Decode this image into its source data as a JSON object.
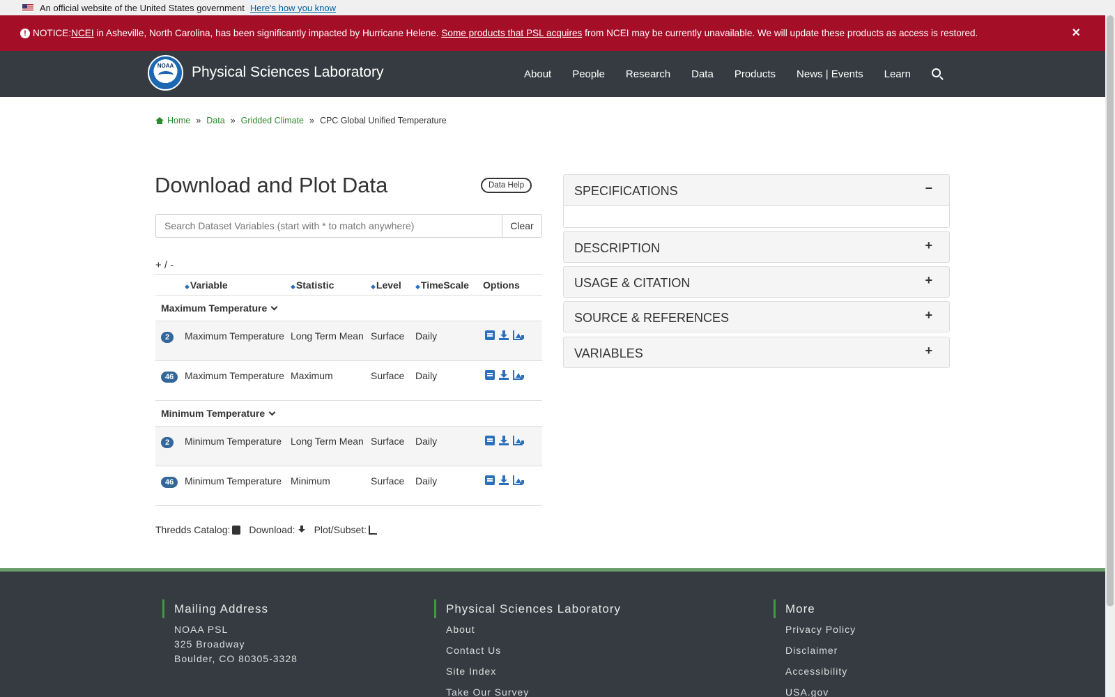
{
  "gov_banner": {
    "text": "An official website of the United States government",
    "link": "Here's how you know"
  },
  "notice": {
    "prefix": "NOTICE: ",
    "ncei_link": "NCEI",
    "text1": " in Asheville, North Carolina, has been significantly impacted by Hurricane Helene. ",
    "products_link": "Some products that PSL acquires",
    "text2": " from NCEI may be currently unavailable. We will update these products as access is restored.",
    "close": "×"
  },
  "header": {
    "logo_text": "NOAA",
    "title": "Physical Sciences Laboratory",
    "nav": [
      "About",
      "People",
      "Research",
      "Data",
      "Products",
      "News | Events",
      "Learn"
    ]
  },
  "breadcrumb": {
    "home": "Home",
    "data": "Data",
    "gridded": "Gridded Climate",
    "current": "CPC Global Unified Temperature",
    "sep": "»"
  },
  "main": {
    "title": "Download and Plot Data",
    "data_help": "Data Help",
    "search_placeholder": "Search Dataset Variables (start with * to match anywhere)",
    "clear": "Clear",
    "plusminus": "+ / -",
    "columns": {
      "variable": "Variable",
      "statistic": "Statistic",
      "level": "Level",
      "timescale": "TimeScale",
      "options": "Options"
    },
    "groups": [
      {
        "name": "Maximum Temperature",
        "rows": [
          {
            "count": "2",
            "variable": "Maximum Temperature",
            "statistic": "Long Term Mean",
            "level": "Surface",
            "timescale": "Daily"
          },
          {
            "count": "46",
            "variable": "Maximum Temperature",
            "statistic": "Maximum",
            "level": "Surface",
            "timescale": "Daily"
          }
        ]
      },
      {
        "name": "Minimum Temperature",
        "rows": [
          {
            "count": "2",
            "variable": "Minimum Temperature",
            "statistic": "Long Term Mean",
            "level": "Surface",
            "timescale": "Daily"
          },
          {
            "count": "46",
            "variable": "Minimum Temperature",
            "statistic": "Minimum",
            "level": "Surface",
            "timescale": "Daily"
          }
        ]
      }
    ],
    "legend": {
      "thredds": "Thredds Catalog:",
      "download": "Download:",
      "plot": "Plot/Subset:"
    }
  },
  "accordion": [
    {
      "title": "SPECIFICATIONS",
      "toggle": "−"
    },
    {
      "title": "DESCRIPTION",
      "toggle": "+"
    },
    {
      "title": "USAGE & CITATION",
      "toggle": "+"
    },
    {
      "title": "SOURCE & REFERENCES",
      "toggle": "+"
    },
    {
      "title": "VARIABLES",
      "toggle": "+"
    }
  ],
  "footer": {
    "mailing": {
      "title": "Mailing Address",
      "lines": [
        "NOAA PSL",
        "325 Broadway",
        "Boulder, CO 80305-3328"
      ]
    },
    "psl": {
      "title": "Physical Sciences Laboratory",
      "links": [
        "About",
        "Contact Us",
        "Site Index",
        "Take Our Survey"
      ]
    },
    "more": {
      "title": "More",
      "links": [
        "Privacy Policy",
        "Disclaimer",
        "Accessibility",
        "USA.gov"
      ]
    }
  }
}
